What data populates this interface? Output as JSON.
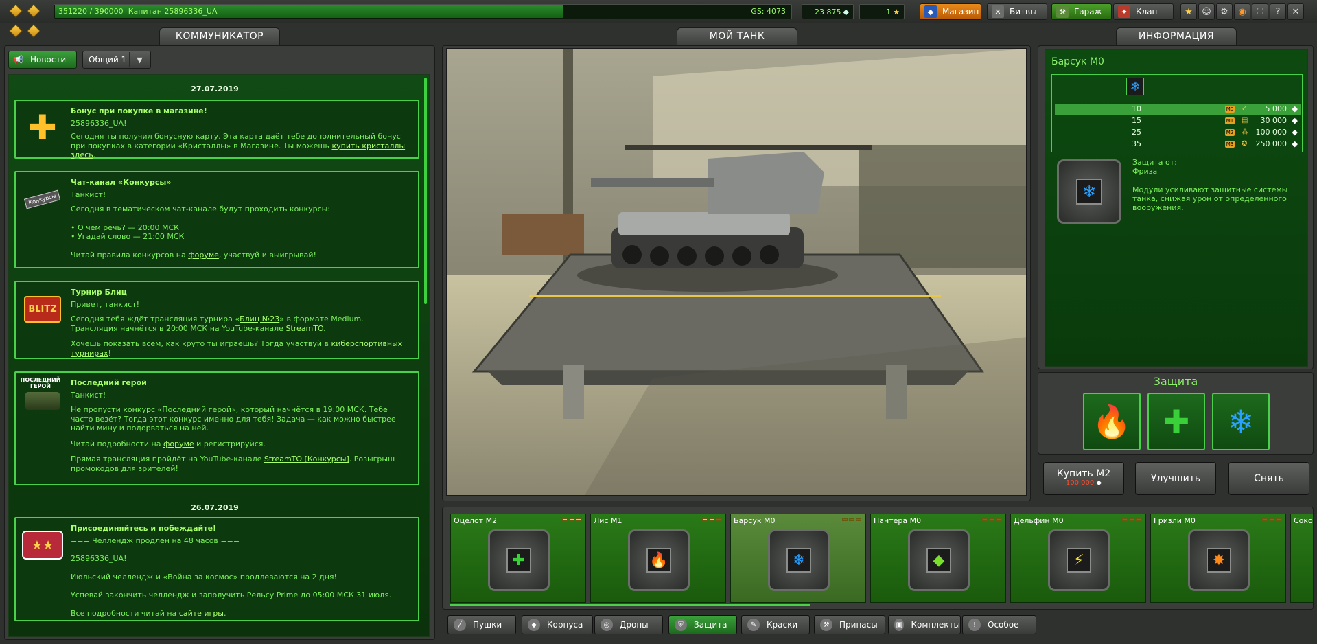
{
  "topbar": {
    "experience": "351220 / 390000",
    "rank_user": "Капитан 25896336_UA",
    "gs": "GS: 4073",
    "crystals": "23 875",
    "stars": "1",
    "shop": "Магазин",
    "battles": "Битвы",
    "garage": "Гараж",
    "clan": "Клан",
    "help": "?"
  },
  "headers": {
    "communicator": "КОММУНИКАТОР",
    "my_tank": "МОЙ ТАНК",
    "information": "ИНФОРМАЦИЯ"
  },
  "communicator": {
    "news_button": "Новости",
    "channel": "Общий 1",
    "date1": "27.07.2019",
    "date2": "26.07.2019",
    "cards": [
      {
        "title": "Бонус при покупке в магазине!",
        "l1": "25896336_UA!",
        "l2": "Сегодня ты получил бонусную карту. Эта карта даёт тебе дополнительный бонус при покупках в категории «Кристаллы» в Магазине. Ты можешь ",
        "link": "купить кристаллы здесь",
        "l3": "."
      },
      {
        "title": "Чат-канал «Конкурсы»",
        "l1": "Танкист!",
        "l2": "Сегодня в тематическом чат-канале будут проходить конкурсы:",
        "l3": "• О чём речь? — 20:00 МСК",
        "l4": "• Угадай слово — 21:00 МСК",
        "l5": "Читай правила конкурсов на ",
        "link": "форуме",
        "l6": ", участвуй и выигрывай!",
        "icon_label": "Конкурсы"
      },
      {
        "title": "Турнир Блиц",
        "l1": "Привет, танкист!",
        "l2a": " Сегодня тебя ждёт трансляция турнира «",
        "link1": "Блиц №23",
        "l2b": "» в формате Medium. Трансляция начнётся в 20:00 МСК на YouTube-канале ",
        "link2": "StreamTO",
        "l2c": ".",
        "l3": "Хочешь показать всем, как круто ты играешь? Тогда участвуй в ",
        "link3": "киберспортивных турнирах",
        "l3b": "!",
        "icon_label": "BLITZ"
      },
      {
        "title": "Последний герой",
        "l1": "Танкист!",
        "l2": "Не пропусти конкурс «Последний герой», который начнётся в 19:00 МСК. Тебе часто везёт? Тогда этот конкурс именно для тебя! Задача — как можно быстрее найти мину и подорваться на ней.",
        "l3": "Читай подробности на ",
        "link": "форуме",
        "l3b": "  и регистрируйся.",
        "l4": "Прямая трансляция пройдёт на YouTube-канале ",
        "link2": "StreamTO [Конкурсы]",
        "l4b": ". Розыгрыш промокодов для зрителей!",
        "icon_label": "ПОСЛЕДНИЙ ГЕРОЙ"
      },
      {
        "title": "Присоединяйтесь и побеждайте!",
        "l1": "=== Челлендж продлён на 48 часов ===",
        "l2": "25896336_UA!",
        "l3": "Июльский челлендж и «Война за космос» продлеваются на 2 дня!",
        "l4": "Успевай закончить челлендж и заполучить Рельсу Prime до 05:00 МСК 31 июля.",
        "l5": "Все подробности читай на ",
        "link": "сайте игры",
        "l5b": "."
      }
    ]
  },
  "info": {
    "title": "Барсук M0",
    "levels": [
      {
        "lvl": "10",
        "mod": "M0",
        "price": "5 000"
      },
      {
        "lvl": "15",
        "mod": "M1",
        "price": "30 000"
      },
      {
        "lvl": "25",
        "mod": "M2",
        "price": "100 000"
      },
      {
        "lvl": "35",
        "mod": "M3",
        "price": "250 000"
      }
    ],
    "protection_from": "Защита от:",
    "protection_target": "Фриза",
    "description": "Модули усиливают защитные системы танка, снижая урон от определённого вооружения."
  },
  "protection": {
    "title": "Защита"
  },
  "actions": {
    "buy": "Купить M2",
    "buy_price": "100 000",
    "upgrade": "Улучшить",
    "remove": "Снять"
  },
  "modules": [
    {
      "name": "Оцелот M2",
      "icon": "+",
      "color": "#3ad03a"
    },
    {
      "name": "Лис M1",
      "icon": "🔥",
      "color": "#ff4a2a"
    },
    {
      "name": "Барсук M0",
      "icon": "❄",
      "color": "#2aa0ff"
    },
    {
      "name": "Пантера M0",
      "icon": "◆",
      "color": "#7adf2a"
    },
    {
      "name": "Дельфин M0",
      "icon": "⚡",
      "color": "#f0e02a"
    },
    {
      "name": "Гризли M0",
      "icon": "✸",
      "color": "#ff8a1a"
    },
    {
      "name": "Соко",
      "icon": "",
      "color": "#fff"
    }
  ],
  "categories": [
    "Пушки",
    "Корпуса",
    "Дроны",
    "Защита",
    "Краски",
    "Припасы",
    "Комплекты",
    "Особое"
  ]
}
